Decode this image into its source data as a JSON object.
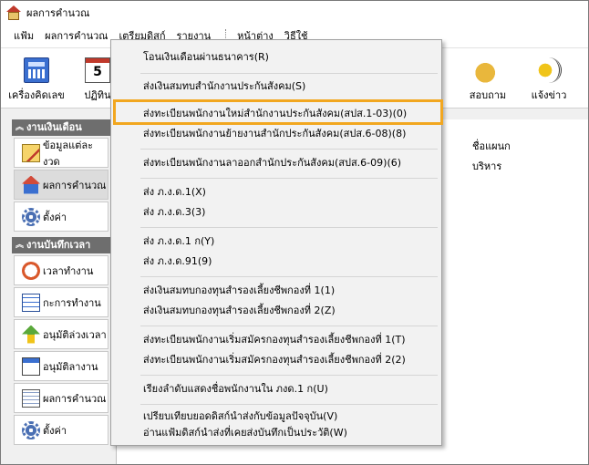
{
  "window": {
    "title": "ผลการคำนวณ"
  },
  "menubar": {
    "items": [
      "แฟ้ม",
      "ผลการคำนวณ",
      "เตรียมดิสก์",
      "รายงาน",
      "หน้าต่าง",
      "วิธีใช้"
    ]
  },
  "toolbar": {
    "left_buttons": [
      {
        "label": "เครื่องคิดเลข",
        "icon": "calculator-icon"
      },
      {
        "label": "ปฏิทิน",
        "icon": "calendar-icon"
      }
    ],
    "right_buttons": [
      {
        "label": "สอบถาม",
        "icon": "phone-icon"
      },
      {
        "label": "แจ้งข่าว",
        "icon": "speaker-icon"
      }
    ]
  },
  "sidebar": {
    "groups": [
      {
        "title": "งานเงินเดือน",
        "items": [
          {
            "label": "ข้อมูลแต่ละงวด",
            "icon": "notepad-icon"
          },
          {
            "label": "ผลการคำนวณ",
            "icon": "house-icon"
          },
          {
            "label": "ตั้งค่า",
            "icon": "gear-icon"
          }
        ]
      },
      {
        "title": "งานบันทึกเวลา",
        "items": [
          {
            "label": "เวลาทำงาน",
            "icon": "clock-icon"
          },
          {
            "label": "กะการทำงาน",
            "icon": "schedule-grid-icon"
          },
          {
            "label": "อนุมัติล่วงเวลา",
            "icon": "approve-arrow-icon"
          },
          {
            "label": "อนุมัติลางาน",
            "icon": "calendar-approve-icon"
          },
          {
            "label": "ผลการคำนวณ",
            "icon": "document-icon"
          },
          {
            "label": "ตั้งค่า",
            "icon": "gear-icon"
          }
        ]
      }
    ]
  },
  "main": {
    "column_header": "ชื่อแผนก",
    "row_value": "บริหาร"
  },
  "dropdown": {
    "items": [
      "โอนเงินเดือนผ่านธนาคาร(R)",
      "ส่งเงินสมทบสำนักงานประกันสังคม(S)",
      "ส่งทะเบียนพนักงานใหม่สำนักงานประกันสังคม(สปส.1-03)(0)",
      "ส่งทะเบียนพนักงานย้ายงานสำนักประกันสังคม(สปส.6-08)(8)",
      "ส่งทะเบียนพนักงานลาออกสำนักประกันสังคม(สปส.6-09)(6)",
      "ส่ง ภ.ง.ด.1(X)",
      "ส่ง ภ.ง.ด.3(3)",
      "ส่ง ภ.ง.ด.1 ก(Y)",
      "ส่ง ภ.ง.ด.91(9)",
      "ส่งเงินสมทบกองทุนสำรองเลี้ยงชีพกองที่ 1(1)",
      "ส่งเงินสมทบกองทุนสำรองเลี้ยงชีพกองที่ 2(Z)",
      "ส่งทะเบียนพนักงานเริ่มสมัครกองทุนสำรองเลี้ยงชีพกองที่ 1(T)",
      "ส่งทะเบียนพนักงานเริ่มสมัครกองทุนสำรองเลี้ยงชีพกองที่ 2(2)",
      "เรียงลำดับแสดงชื่อพนักงานใน ภงด.1 ก(U)",
      "เปรียบเทียบยอดดิสก์นำส่งกับข้อมูลปัจจุบัน(V)",
      "อ่านแฟ้มดิสก์นำส่งที่เคยส่งบันทึกเป็นประวัติ(W)"
    ]
  },
  "colors": {
    "highlight": "#f2a720",
    "sidebar_header": "#6e6e6e"
  }
}
